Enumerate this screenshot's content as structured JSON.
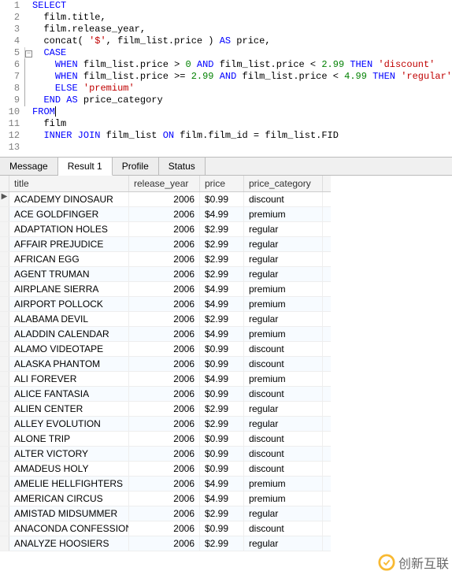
{
  "code": {
    "lines": [
      {
        "n": 1,
        "fold": "",
        "tokens": [
          [
            "kw",
            "SELECT"
          ]
        ]
      },
      {
        "n": 2,
        "fold": "",
        "tokens": [
          [
            "id",
            "  film.title,"
          ]
        ]
      },
      {
        "n": 3,
        "fold": "",
        "tokens": [
          [
            "id",
            "  film.release_year,"
          ]
        ]
      },
      {
        "n": 4,
        "fold": "",
        "tokens": [
          [
            "id",
            "  concat( "
          ],
          [
            "str",
            "'$'"
          ],
          [
            "id",
            ", film_list.price ) "
          ],
          [
            "kw",
            "AS"
          ],
          [
            "id",
            " price,"
          ]
        ]
      },
      {
        "n": 5,
        "fold": "minus",
        "tokens": [
          [
            "id",
            "  "
          ],
          [
            "kw",
            "CASE"
          ]
        ]
      },
      {
        "n": 6,
        "fold": "line",
        "tokens": [
          [
            "id",
            "    "
          ],
          [
            "kw",
            "WHEN"
          ],
          [
            "id",
            " film_list.price > "
          ],
          [
            "num",
            "0"
          ],
          [
            "id",
            " "
          ],
          [
            "kw",
            "AND"
          ],
          [
            "id",
            " film_list.price < "
          ],
          [
            "num",
            "2.99"
          ],
          [
            "id",
            " "
          ],
          [
            "kw",
            "THEN"
          ],
          [
            "id",
            " "
          ],
          [
            "str",
            "'discount'"
          ]
        ]
      },
      {
        "n": 7,
        "fold": "line",
        "tokens": [
          [
            "id",
            "    "
          ],
          [
            "kw",
            "WHEN"
          ],
          [
            "id",
            " film_list.price >= "
          ],
          [
            "num",
            "2.99"
          ],
          [
            "id",
            " "
          ],
          [
            "kw",
            "AND"
          ],
          [
            "id",
            " film_list.price < "
          ],
          [
            "num",
            "4.99"
          ],
          [
            "id",
            " "
          ],
          [
            "kw",
            "THEN"
          ],
          [
            "id",
            " "
          ],
          [
            "str",
            "'regular'"
          ]
        ]
      },
      {
        "n": 8,
        "fold": "line",
        "tokens": [
          [
            "id",
            "    "
          ],
          [
            "kw",
            "ELSE"
          ],
          [
            "id",
            " "
          ],
          [
            "str",
            "'premium'"
          ]
        ]
      },
      {
        "n": 9,
        "fold": "end",
        "tokens": [
          [
            "id",
            "  "
          ],
          [
            "kw",
            "END"
          ],
          [
            "id",
            " "
          ],
          [
            "kw",
            "AS"
          ],
          [
            "id",
            " price_category"
          ]
        ]
      },
      {
        "n": 10,
        "fold": "",
        "tokens": [
          [
            "kw",
            "FROM"
          ],
          [
            "cursor",
            ""
          ]
        ]
      },
      {
        "n": 11,
        "fold": "",
        "tokens": [
          [
            "id",
            "  film"
          ]
        ]
      },
      {
        "n": 12,
        "fold": "",
        "tokens": [
          [
            "id",
            "  "
          ],
          [
            "kw",
            "INNER"
          ],
          [
            "id",
            " "
          ],
          [
            "kw",
            "JOIN"
          ],
          [
            "id",
            " film_list "
          ],
          [
            "kw",
            "ON"
          ],
          [
            "id",
            " film.film_id = film_list.FID"
          ]
        ]
      },
      {
        "n": 13,
        "fold": "",
        "tokens": []
      }
    ]
  },
  "tabs": [
    "Message",
    "Result 1",
    "Profile",
    "Status"
  ],
  "active_tab": 1,
  "columns": [
    "title",
    "release_year",
    "price",
    "price_category"
  ],
  "rows": [
    {
      "mark": "▶",
      "title": "ACADEMY DINOSAUR",
      "release_year": "2006",
      "price": "$0.99",
      "price_category": "discount"
    },
    {
      "mark": "",
      "title": "ACE GOLDFINGER",
      "release_year": "2006",
      "price": "$4.99",
      "price_category": "premium"
    },
    {
      "mark": "",
      "title": "ADAPTATION HOLES",
      "release_year": "2006",
      "price": "$2.99",
      "price_category": "regular"
    },
    {
      "mark": "",
      "title": "AFFAIR PREJUDICE",
      "release_year": "2006",
      "price": "$2.99",
      "price_category": "regular"
    },
    {
      "mark": "",
      "title": "AFRICAN EGG",
      "release_year": "2006",
      "price": "$2.99",
      "price_category": "regular"
    },
    {
      "mark": "",
      "title": "AGENT TRUMAN",
      "release_year": "2006",
      "price": "$2.99",
      "price_category": "regular"
    },
    {
      "mark": "",
      "title": "AIRPLANE SIERRA",
      "release_year": "2006",
      "price": "$4.99",
      "price_category": "premium"
    },
    {
      "mark": "",
      "title": "AIRPORT POLLOCK",
      "release_year": "2006",
      "price": "$4.99",
      "price_category": "premium"
    },
    {
      "mark": "",
      "title": "ALABAMA DEVIL",
      "release_year": "2006",
      "price": "$2.99",
      "price_category": "regular"
    },
    {
      "mark": "",
      "title": "ALADDIN CALENDAR",
      "release_year": "2006",
      "price": "$4.99",
      "price_category": "premium"
    },
    {
      "mark": "",
      "title": "ALAMO VIDEOTAPE",
      "release_year": "2006",
      "price": "$0.99",
      "price_category": "discount"
    },
    {
      "mark": "",
      "title": "ALASKA PHANTOM",
      "release_year": "2006",
      "price": "$0.99",
      "price_category": "discount"
    },
    {
      "mark": "",
      "title": "ALI FOREVER",
      "release_year": "2006",
      "price": "$4.99",
      "price_category": "premium"
    },
    {
      "mark": "",
      "title": "ALICE FANTASIA",
      "release_year": "2006",
      "price": "$0.99",
      "price_category": "discount"
    },
    {
      "mark": "",
      "title": "ALIEN CENTER",
      "release_year": "2006",
      "price": "$2.99",
      "price_category": "regular"
    },
    {
      "mark": "",
      "title": "ALLEY EVOLUTION",
      "release_year": "2006",
      "price": "$2.99",
      "price_category": "regular"
    },
    {
      "mark": "",
      "title": "ALONE TRIP",
      "release_year": "2006",
      "price": "$0.99",
      "price_category": "discount"
    },
    {
      "mark": "",
      "title": "ALTER VICTORY",
      "release_year": "2006",
      "price": "$0.99",
      "price_category": "discount"
    },
    {
      "mark": "",
      "title": "AMADEUS HOLY",
      "release_year": "2006",
      "price": "$0.99",
      "price_category": "discount"
    },
    {
      "mark": "",
      "title": "AMELIE HELLFIGHTERS",
      "release_year": "2006",
      "price": "$4.99",
      "price_category": "premium"
    },
    {
      "mark": "",
      "title": "AMERICAN CIRCUS",
      "release_year": "2006",
      "price": "$4.99",
      "price_category": "premium"
    },
    {
      "mark": "",
      "title": "AMISTAD MIDSUMMER",
      "release_year": "2006",
      "price": "$2.99",
      "price_category": "regular"
    },
    {
      "mark": "",
      "title": "ANACONDA CONFESSIONS",
      "release_year": "2006",
      "price": "$0.99",
      "price_category": "discount"
    },
    {
      "mark": "",
      "title": "ANALYZE HOOSIERS",
      "release_year": "2006",
      "price": "$2.99",
      "price_category": "regular"
    }
  ],
  "watermark": {
    "text": "创新互联"
  }
}
